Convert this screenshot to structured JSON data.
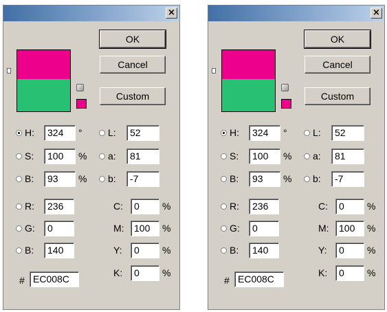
{
  "dialogs": [
    {
      "close_label": "×",
      "buttons": {
        "ok": "OK",
        "cancel": "Cancel",
        "custom": "Custom"
      },
      "colors": {
        "new": "#ec008c",
        "old": "#28c173",
        "gamut": "#ec008c"
      },
      "hsb": [
        {
          "label": "H:",
          "value": "324",
          "unit": "°",
          "selected": true
        },
        {
          "label": "S:",
          "value": "100",
          "unit": "%",
          "selected": false
        },
        {
          "label": "B:",
          "value": "93",
          "unit": "%",
          "selected": false
        }
      ],
      "lab": [
        {
          "label": "L:",
          "value": "52"
        },
        {
          "label": "a:",
          "value": "81"
        },
        {
          "label": "b:",
          "value": "-7"
        }
      ],
      "rgb": [
        {
          "label": "R:",
          "value": "236"
        },
        {
          "label": "G:",
          "value": "0"
        },
        {
          "label": "B:",
          "value": "140"
        }
      ],
      "cmyk": [
        {
          "label": "C:",
          "value": "0",
          "unit": "%"
        },
        {
          "label": "M:",
          "value": "100",
          "unit": "%"
        },
        {
          "label": "Y:",
          "value": "0",
          "unit": "%"
        },
        {
          "label": "K:",
          "value": "0",
          "unit": "%"
        }
      ],
      "hex": {
        "label": "#",
        "value": "EC008C"
      }
    },
    {
      "close_label": "×",
      "buttons": {
        "ok": "OK",
        "cancel": "Cancel",
        "custom": "Custom"
      },
      "colors": {
        "new": "#ec008c",
        "old": "#28c173",
        "gamut": "#ec008c"
      },
      "hsb": [
        {
          "label": "H:",
          "value": "324",
          "unit": "°",
          "selected": true
        },
        {
          "label": "S:",
          "value": "100",
          "unit": "%",
          "selected": false
        },
        {
          "label": "B:",
          "value": "93",
          "unit": "%",
          "selected": false
        }
      ],
      "lab": [
        {
          "label": "L:",
          "value": "52"
        },
        {
          "label": "a:",
          "value": "81"
        },
        {
          "label": "b:",
          "value": "-7"
        }
      ],
      "rgb": [
        {
          "label": "R:",
          "value": "236"
        },
        {
          "label": "G:",
          "value": "0"
        },
        {
          "label": "B:",
          "value": "140"
        }
      ],
      "cmyk": [
        {
          "label": "C:",
          "value": "0",
          "unit": "%"
        },
        {
          "label": "M:",
          "value": "100",
          "unit": "%"
        },
        {
          "label": "Y:",
          "value": "0",
          "unit": "%"
        },
        {
          "label": "K:",
          "value": "0",
          "unit": "%"
        }
      ],
      "hex": {
        "label": "#",
        "value": "EC008C"
      }
    }
  ]
}
